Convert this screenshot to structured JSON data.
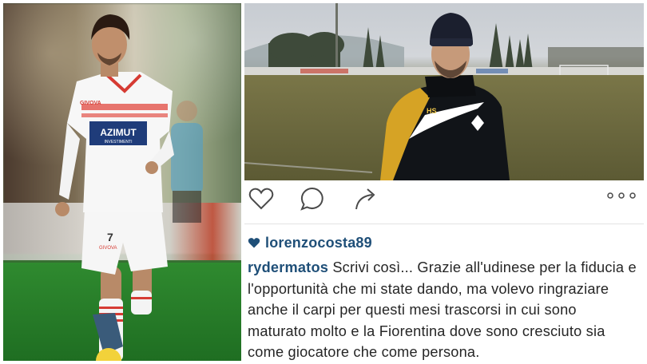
{
  "photos": {
    "left": {
      "subject": "footballer-white-kit",
      "shirt_sponsor": "AZIMUT",
      "shirt_sponsor_sub": "INVESTIMENTI",
      "shirt_number": "7",
      "kit_brand": "GIVOVA"
    },
    "right": {
      "subject": "footballer-black-beanie",
      "jacket_mark": "HS"
    }
  },
  "post": {
    "actions": {
      "like_icon": "heart-outline-icon",
      "comment_icon": "speech-bubble-icon",
      "share_icon": "share-arrow-icon",
      "more_icon": "more-dots-icon"
    },
    "liked_by": "lorenzocosta89",
    "caption": {
      "author": "rydermatos",
      "text": "Scrivi così... Grazie all'udinese per la fiducia e l'opportunità che mi state dando, ma volevo ringraziare anche il carpi per questi mesi trascorsi in cui sono maturato molto e la Fiorentina dove sono cresciuto sia come giocatore che come persona."
    }
  },
  "colors": {
    "username_blue": "#1f4f78",
    "text": "#262626",
    "icon_gray": "#4a4a4a",
    "divider": "#e3e3e3"
  }
}
